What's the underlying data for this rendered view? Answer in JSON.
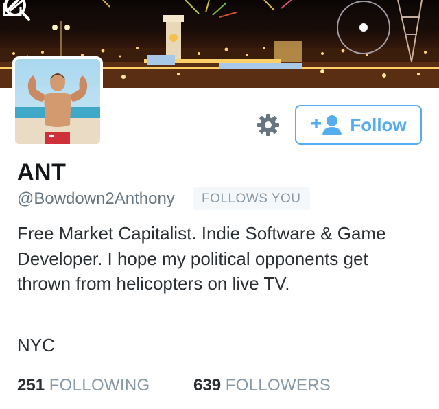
{
  "header": {
    "back_icon": "back-arrow-icon",
    "search_icon": "search-icon",
    "compose_icon": "compose-icon"
  },
  "profile": {
    "name": "ANT",
    "handle": "@Bowdown2Anthony",
    "follows_you": "FOLLOWS YOU",
    "bio": "Free Market Capitalist. Indie Software & Game Developer. I hope my political opponents get thrown from helicopters on live TV.",
    "location": "NYC"
  },
  "actions": {
    "settings_icon": "gear-icon",
    "follow_label": "Follow",
    "follow_icon": "add-user-icon"
  },
  "stats": {
    "following_count": "251",
    "following_label": "FOLLOWING",
    "followers_count": "639",
    "followers_label": "FOLLOWERS"
  },
  "colors": {
    "accent": "#55acee",
    "muted": "#8899a6",
    "text": "#292f33"
  }
}
